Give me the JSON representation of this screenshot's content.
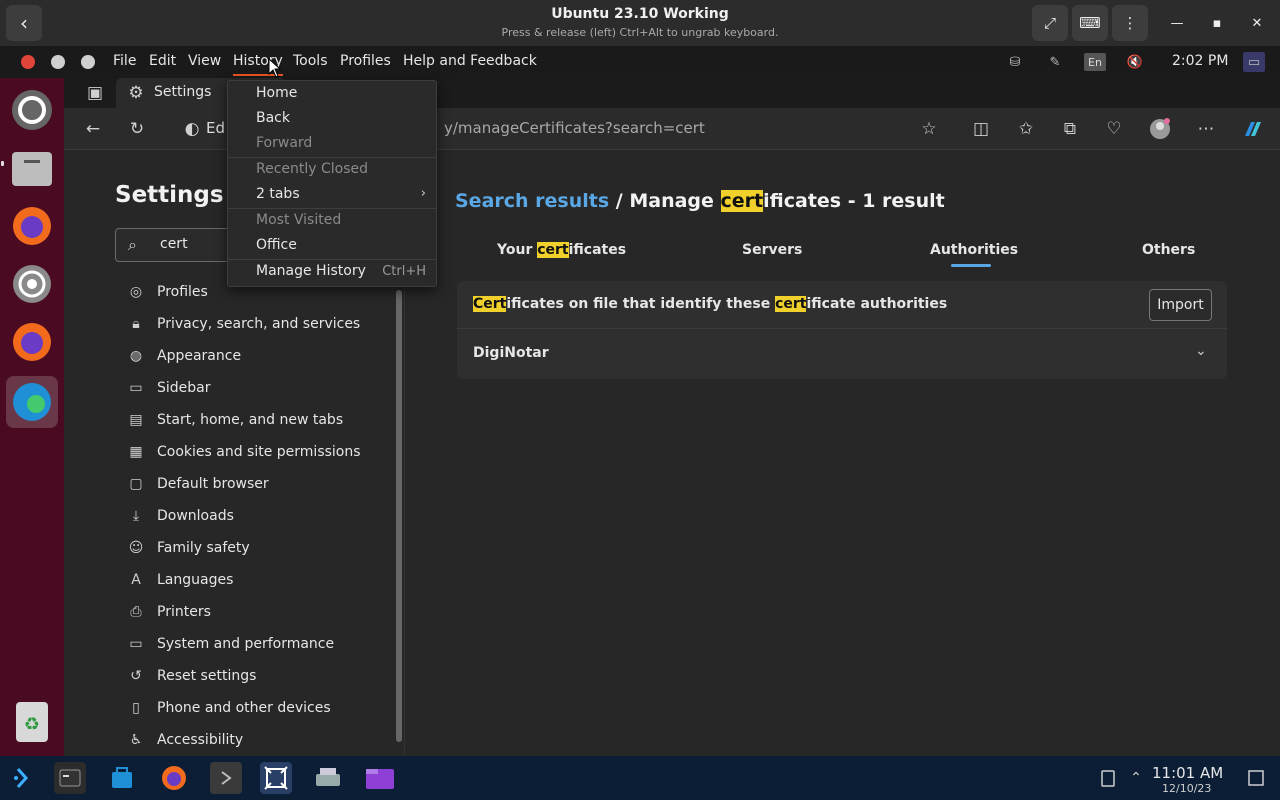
{
  "viewer": {
    "title": "Ubuntu 23.10 Working",
    "subtitle": "Press & release (left) Ctrl+Alt to ungrab keyboard."
  },
  "menubar": {
    "items": [
      "File",
      "Edit",
      "View",
      "History",
      "Tools",
      "Profiles",
      "Help and Feedback"
    ],
    "clock": "2:02 PM",
    "keyboard_layout": "En"
  },
  "browser": {
    "tab_label": "Settings",
    "address_lead": "Ed",
    "address_text": "y/manageCertificates?search=cert"
  },
  "settings": {
    "title": "Settings",
    "search_value": "cert",
    "nav": [
      {
        "label": "Profiles",
        "icon": "profile-icon"
      },
      {
        "label": "Privacy, search, and services",
        "icon": "lock-icon"
      },
      {
        "label": "Appearance",
        "icon": "appearance-icon"
      },
      {
        "label": "Sidebar",
        "icon": "sidebar-icon"
      },
      {
        "label": "Start, home, and new tabs",
        "icon": "home-icon"
      },
      {
        "label": "Cookies and site permissions",
        "icon": "cookie-icon"
      },
      {
        "label": "Default browser",
        "icon": "browser-icon"
      },
      {
        "label": "Downloads",
        "icon": "download-icon"
      },
      {
        "label": "Family safety",
        "icon": "family-icon"
      },
      {
        "label": "Languages",
        "icon": "language-icon"
      },
      {
        "label": "Printers",
        "icon": "printer-icon"
      },
      {
        "label": "System and performance",
        "icon": "laptop-icon"
      },
      {
        "label": "Reset settings",
        "icon": "reset-icon"
      },
      {
        "label": "Phone and other devices",
        "icon": "phone-icon"
      },
      {
        "label": "Accessibility",
        "icon": "accessibility-icon"
      }
    ],
    "results": {
      "link": "Search results",
      "sep": " / Manage ",
      "hl": "cert",
      "rest": "ificates - 1 result"
    },
    "tabs": {
      "your_pre": "Your ",
      "your_hl": "cert",
      "your_post": "ificates",
      "servers": "Servers",
      "authorities": "Authorities",
      "others": "Others",
      "active": "Authorities"
    },
    "card": {
      "hl1": "Cert",
      "mid": "ificates on file that identify these ",
      "hl2": "cert",
      "end": "ificate authorities",
      "import_label": "Import",
      "entry": "DigiNotar"
    }
  },
  "history_menu": [
    {
      "label": "Home",
      "enabled": true
    },
    {
      "label": "Back",
      "enabled": true
    },
    {
      "label": "Forward",
      "enabled": false
    },
    {
      "label": "Recently Closed",
      "enabled": false
    },
    {
      "label": "2 tabs",
      "enabled": true,
      "submenu": true
    },
    {
      "label": "Most Visited",
      "enabled": false
    },
    {
      "label": "Office",
      "enabled": true
    },
    {
      "label": "Manage History",
      "enabled": true,
      "accel": "Ctrl+H"
    }
  ],
  "host": {
    "time": "11:01 AM",
    "date": "12/10/23"
  },
  "colors": {
    "accent": "#5aa7e6",
    "highlight": "#f0d12b",
    "ubuntu_orange": "#e95420",
    "dock": "#4a0b22"
  }
}
